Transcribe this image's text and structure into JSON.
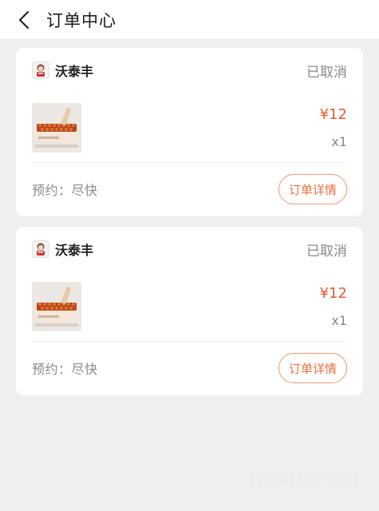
{
  "header": {
    "title": "订单中心",
    "back_icon": "chevron-left-icon"
  },
  "orders": [
    {
      "shop_name": "沃泰丰",
      "status": "已取消",
      "price": "¥12",
      "qty": "x1",
      "reserve": "预约：尽快",
      "detail_label": "订单详情"
    },
    {
      "shop_name": "沃泰丰",
      "status": "已取消",
      "price": "¥12",
      "qty": "x1",
      "reserve": "预约：尽快",
      "detail_label": "订单详情"
    }
  ],
  "watermark": "百姓网用户上传",
  "colors": {
    "accent": "#e8703f",
    "price": "#e85a2c",
    "status": "#888888",
    "background": "#efefef"
  }
}
